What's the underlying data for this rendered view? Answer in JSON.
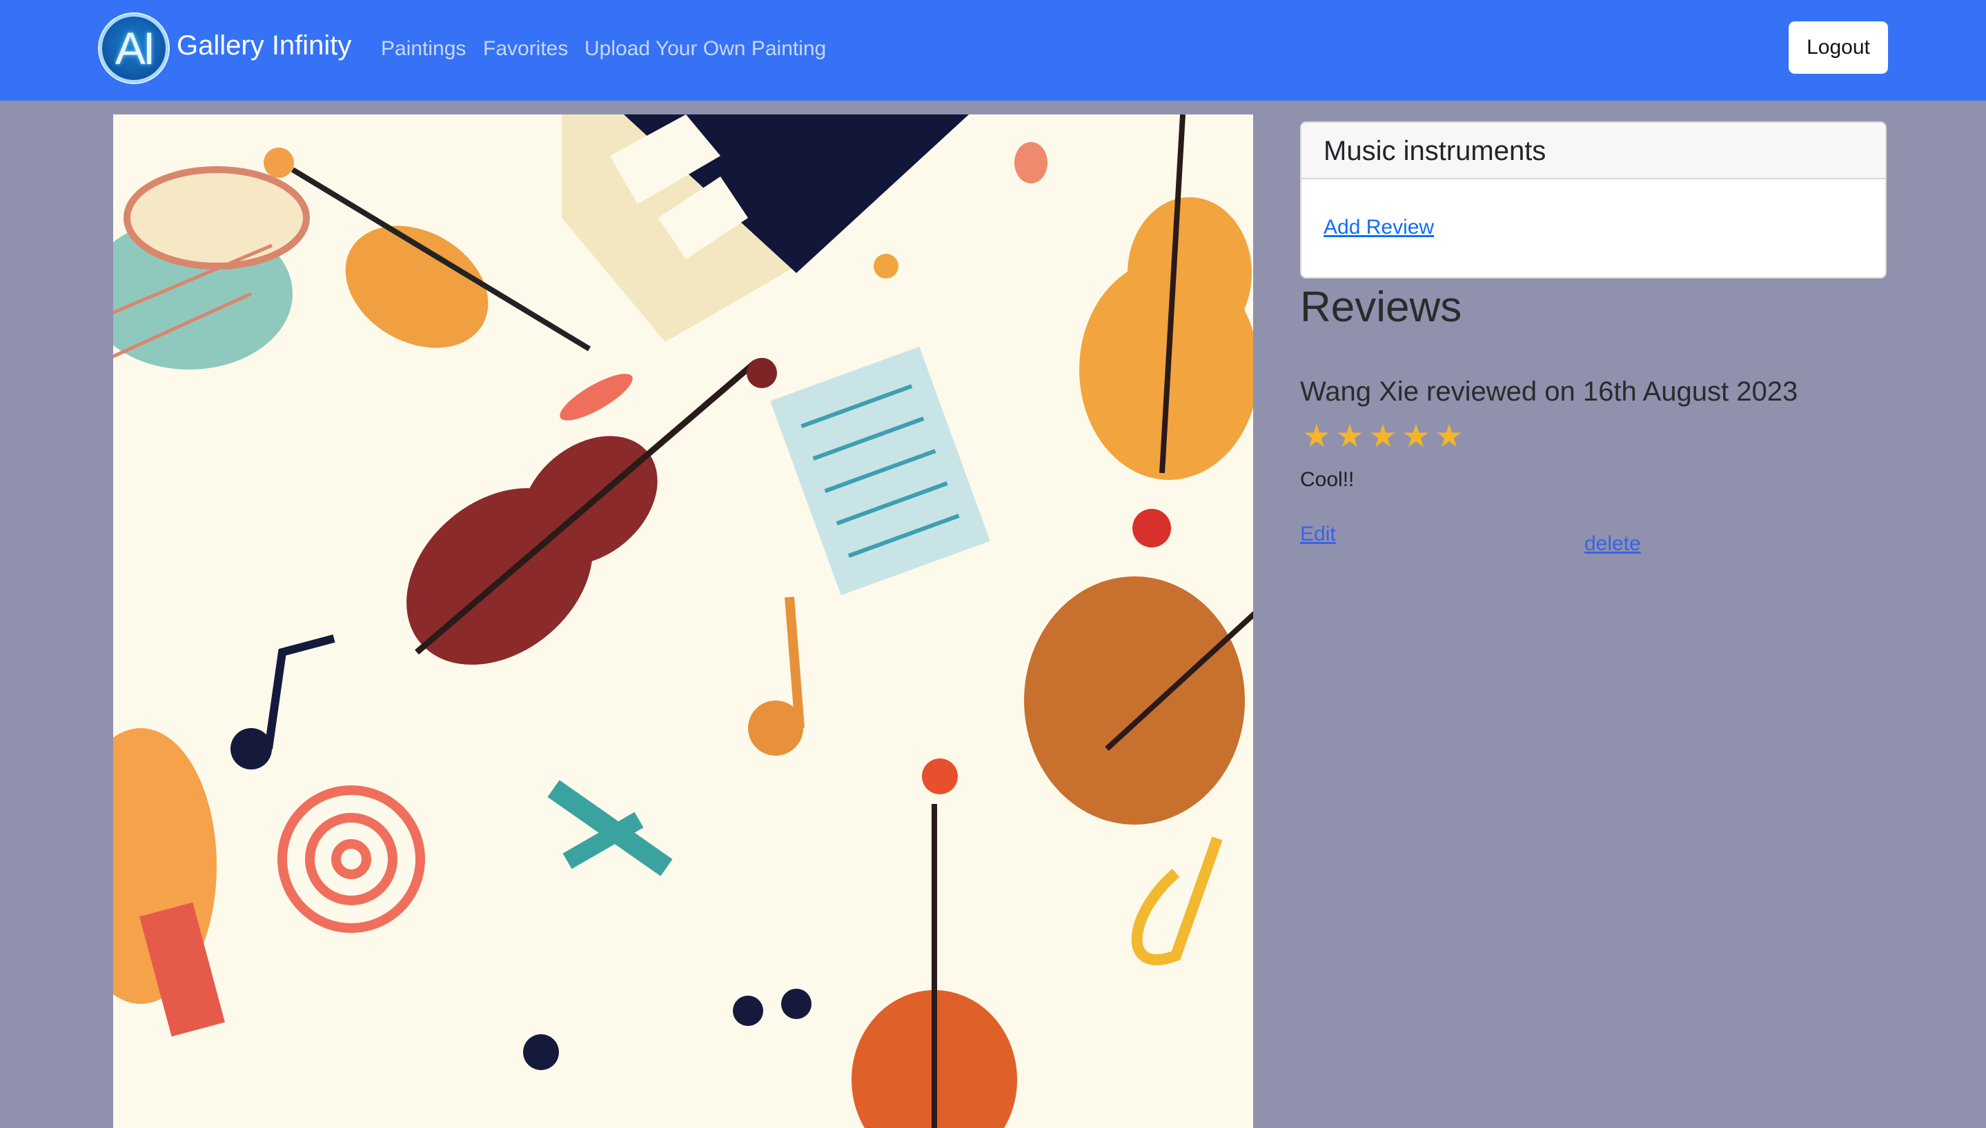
{
  "navbar": {
    "logo_text": "AI",
    "brand": "Gallery Infinity",
    "links": [
      "Paintings",
      "Favorites",
      "Upload Your Own Painting"
    ],
    "logout_label": "Logout",
    "background_color": "#3672f6"
  },
  "painting": {
    "subject": "music instruments illustration"
  },
  "card": {
    "title": "Music instruments",
    "add_review_label": "Add Review"
  },
  "reviews": {
    "heading": "Reviews",
    "items": [
      {
        "title": "Wang Xie reviewed on 16th August 2023",
        "rating": 5,
        "rating_max": 5,
        "text": "Cool!!",
        "edit_label": "Edit",
        "delete_label": "delete"
      }
    ]
  },
  "colors": {
    "page_background": "#9091ad",
    "star": "#f4b528",
    "link": "#3a62e6"
  }
}
